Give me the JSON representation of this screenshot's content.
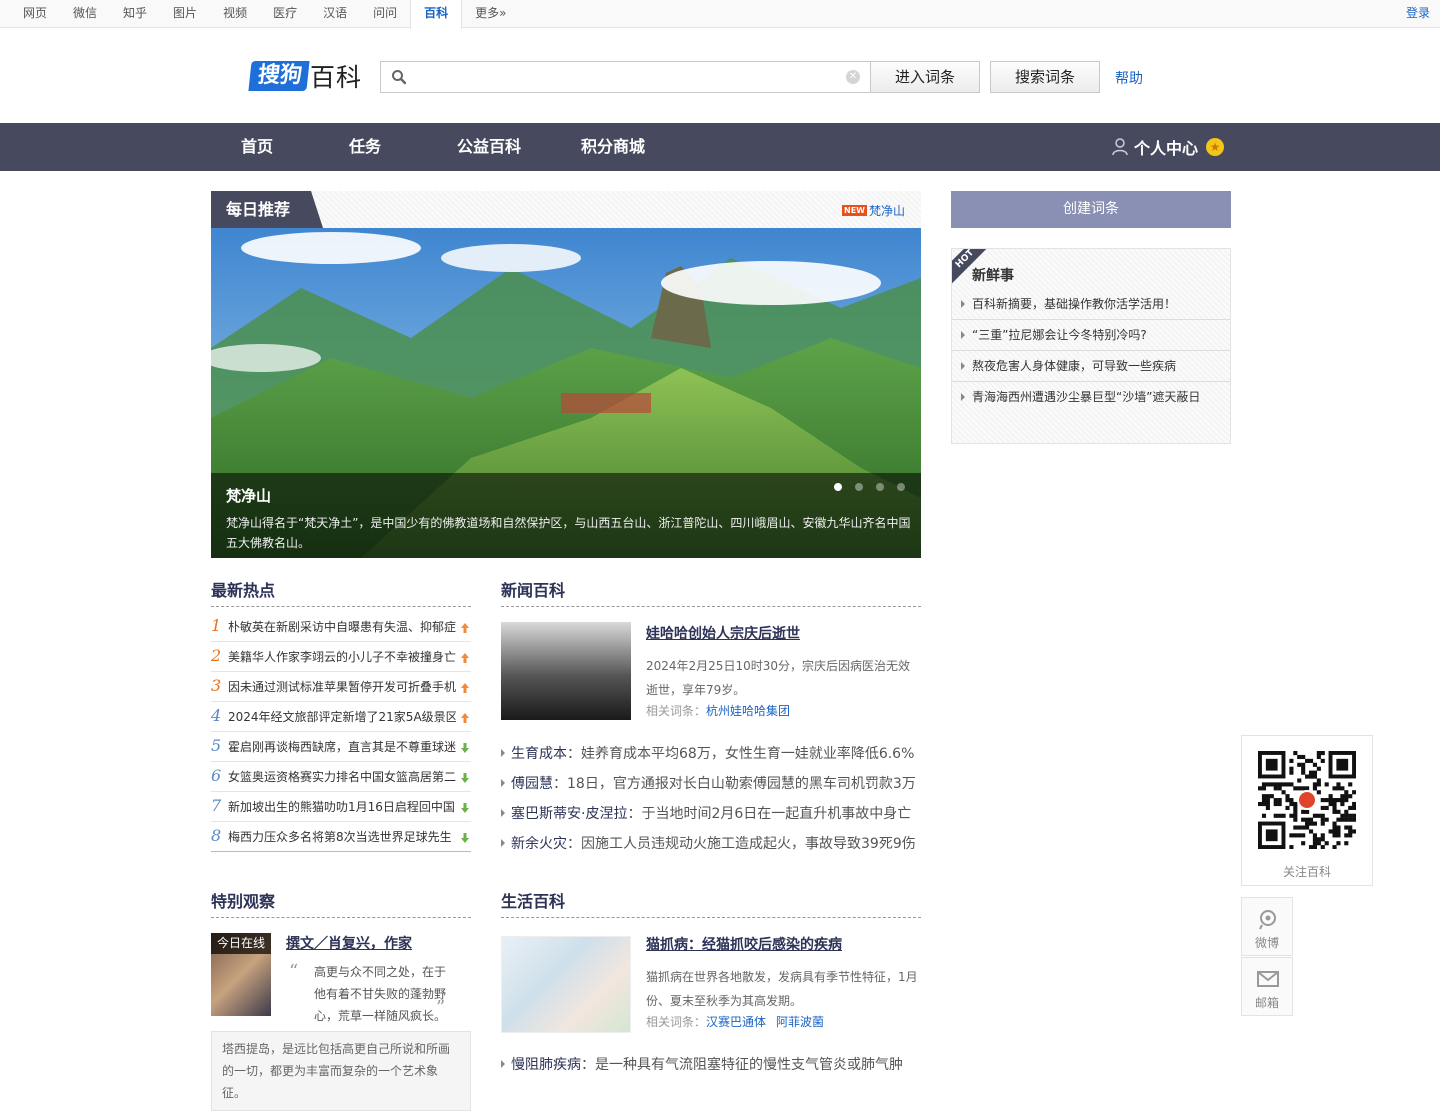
{
  "topbar": {
    "nav": [
      "网页",
      "微信",
      "知乎",
      "图片",
      "视频",
      "医疗",
      "汉语",
      "问问",
      "百科",
      "更多»"
    ],
    "active": "百科",
    "login": "登录"
  },
  "header": {
    "logo_sogou": "搜狗",
    "logo_baike": "百科",
    "search_placeholder": "",
    "enter_label": "进入词条",
    "search_label": "搜索词条",
    "help_label": "帮助"
  },
  "mainnav": {
    "items": [
      "首页",
      "任务",
      "公益百科",
      "积分商城"
    ],
    "personal": "个人中心"
  },
  "daily": {
    "tag": "每日推荐",
    "new_badge": "NEW",
    "new_link": "梵净山",
    "caption_title": "梵净山",
    "caption_desc": "梵净山得名于“梵天净土”，是中国少有的佛教道场和自然保护区，与山西五台山、浙江普陀山、四川峨眉山、安徽九华山齐名中国五大佛教名山。"
  },
  "hot": {
    "title": "最新热点",
    "items": [
      {
        "num": "1",
        "text": "朴敏英在新剧采访中自曝患有失温、抑郁症",
        "trend": "up",
        "color": "#e8731a"
      },
      {
        "num": "2",
        "text": "美籍华人作家李翊云的小儿子不幸被撞身亡",
        "trend": "up",
        "color": "#e8731a"
      },
      {
        "num": "3",
        "text": "因未通过测试标准苹果暂停开发可折叠手机",
        "trend": "up",
        "color": "#e8731a"
      },
      {
        "num": "4",
        "text": "2024年经文旅部评定新增了21家5A级景区",
        "trend": "up",
        "color": "#5a8ac6"
      },
      {
        "num": "5",
        "text": "霍启刚再谈梅西缺席，直言其是不尊重球迷",
        "trend": "down",
        "color": "#5a8ac6"
      },
      {
        "num": "6",
        "text": "女篮奥运资格赛实力排名中国女篮高居第二",
        "trend": "down",
        "color": "#5a8ac6"
      },
      {
        "num": "7",
        "text": "新加坡出生的熊猫叻叻1月16日启程回中国",
        "trend": "down",
        "color": "#5a8ac6"
      },
      {
        "num": "8",
        "text": "梅西力压众多名将第8次当选世界足球先生",
        "trend": "down",
        "color": "#5a8ac6"
      }
    ]
  },
  "news": {
    "title": "新闻百科",
    "feature": {
      "title": "娃哈哈创始人宗庆后逝世",
      "desc": "2024年2月25日10时30分，宗庆后因病医治无效逝世，享年79岁。",
      "rel_label": "相关词条：",
      "rel_links": [
        "杭州娃哈哈集团"
      ]
    },
    "items": [
      {
        "k": "生育成本",
        "v": "娃养育成本平均68万，女性生育一娃就业率降低6.6%"
      },
      {
        "k": "傅园慧",
        "v": "18日，官方通报对长白山勒索傅园慧的黑车司机罚款3万"
      },
      {
        "k": "塞巴斯蒂安·皮涅拉",
        "v": "于当地时间2月6日在一起直升机事故中身亡"
      },
      {
        "k": "新余火灾",
        "v": "因施工人员违规动火施工造成起火，事故导致39死9伤"
      }
    ]
  },
  "observe": {
    "title": "特别观察",
    "badge": "今日在线",
    "item_title": "撰文／肖复兴，作家",
    "quote": "高更与众不同之处，在于他有着不甘失败的蓬勃野心，荒草一样随风疯长。",
    "note": "塔西提岛，是远比包括高更自己所说和所画的一切，都更为丰富而复杂的一个艺术象征。"
  },
  "life": {
    "title": "生活百科",
    "feature": {
      "title": "猫抓病：经猫抓咬后感染的疾病",
      "desc": "猫抓病在世界各地散发，发病具有季节性特征，1月份、夏末至秋季为其高发期。",
      "rel_label": "相关词条：",
      "rel_links": [
        "汉赛巴通体",
        "阿菲波菌"
      ]
    },
    "items": [
      {
        "k": "慢阻肺疾病",
        "v": "是一种具有气流阻塞特征的慢性支气管炎或肺气肿"
      }
    ]
  },
  "right": {
    "create": "创建词条",
    "hot_badge": "HOT",
    "fresh_title": "新鲜事",
    "fresh_items": [
      "百科新摘要，基础操作教你活学活用！",
      "“三重”拉尼娜会让今冬特别冷吗?",
      "熬夜危害人身体健康，可导致一些疾病",
      "青海海西州遭遇沙尘暴巨型“沙墙”遮天蔽日"
    ]
  },
  "side": {
    "qr_caption": "关注百科",
    "weibo": "微博",
    "mail": "邮箱"
  }
}
